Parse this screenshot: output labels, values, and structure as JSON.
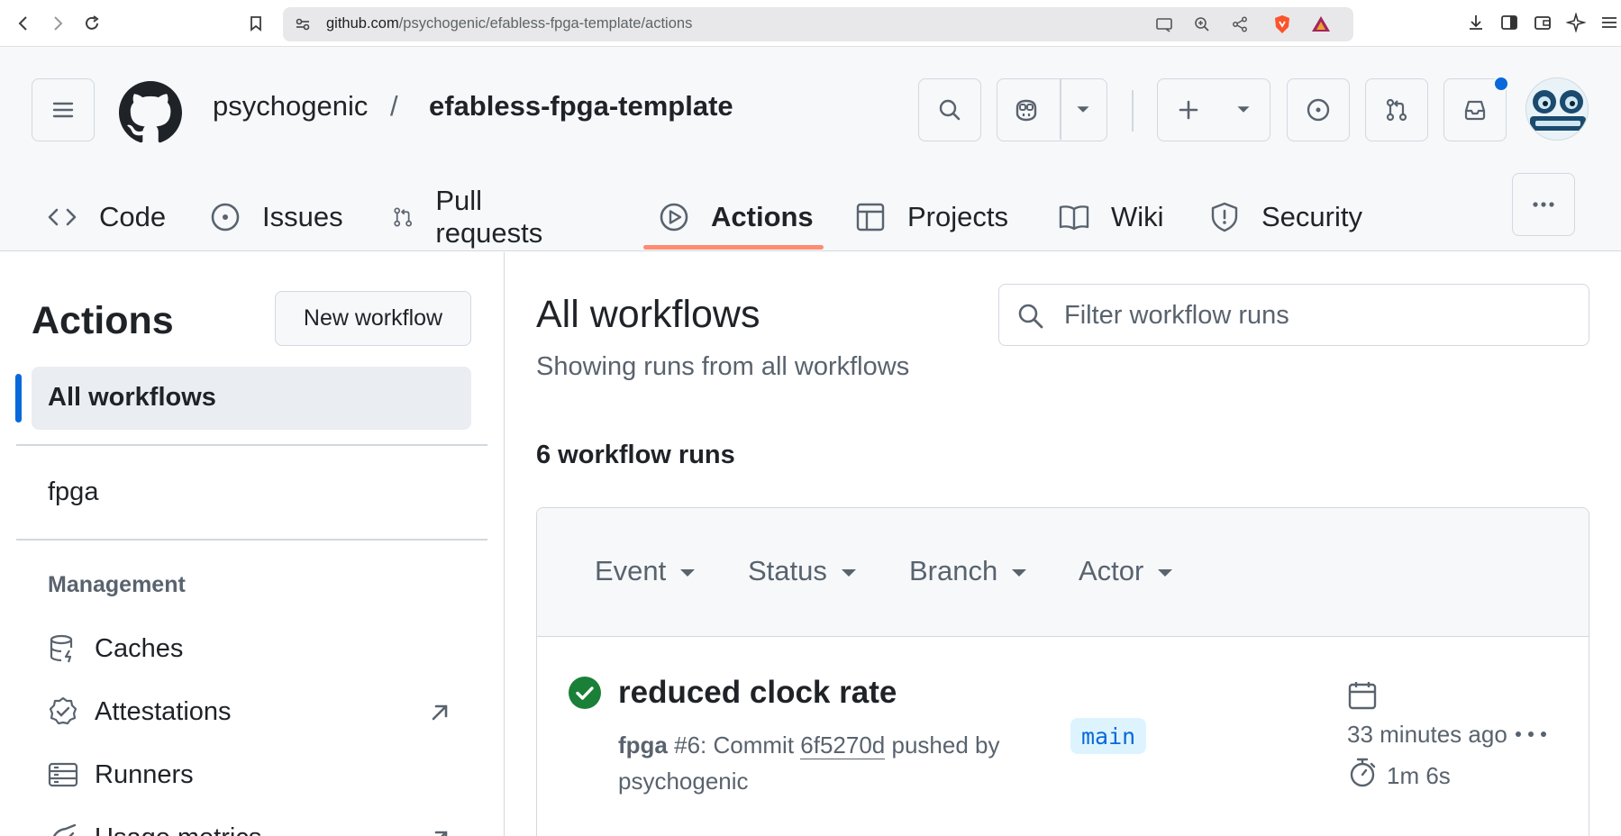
{
  "browser": {
    "url_host": "github.com",
    "url_path": "/psychogenic/efabless-fpga-template/actions"
  },
  "header": {
    "owner": "psychogenic",
    "separator": "/",
    "repo": "efabless-fpga-template"
  },
  "repo_nav": {
    "tabs": [
      {
        "label": "Code",
        "icon": "code-icon"
      },
      {
        "label": "Issues",
        "icon": "issue-opened-icon"
      },
      {
        "label": "Pull requests",
        "icon": "git-pull-request-icon"
      },
      {
        "label": "Actions",
        "icon": "play-icon",
        "active": true
      },
      {
        "label": "Projects",
        "icon": "table-icon"
      },
      {
        "label": "Wiki",
        "icon": "book-icon"
      },
      {
        "label": "Security",
        "icon": "shield-icon"
      }
    ]
  },
  "sidebar": {
    "title": "Actions",
    "new_workflow": "New workflow",
    "all_workflows": "All workflows",
    "workflow_fpga": "fpga",
    "management_heading": "Management",
    "management_items": [
      {
        "label": "Caches",
        "icon": "database-icon"
      },
      {
        "label": "Attestations",
        "icon": "verified-icon",
        "external": true
      },
      {
        "label": "Runners",
        "icon": "server-icon"
      },
      {
        "label": "Usage metrics",
        "icon": "graph-icon",
        "external": true
      }
    ]
  },
  "main": {
    "title": "All workflows",
    "subtitle": "Showing runs from all workflows",
    "filter_placeholder": "Filter workflow runs",
    "runs_count": "6 workflow runs",
    "filters": [
      "Event",
      "Status",
      "Branch",
      "Actor"
    ],
    "runs": [
      {
        "status": "success",
        "title": "reduced clock rate",
        "workflow": "fpga",
        "run_number": "#6",
        "meta_mid": ": Commit ",
        "commit": "6f5270d",
        "meta_tail": " pushed by",
        "actor": "psychogenic",
        "branch": "main",
        "time_ago": "33 minutes ago",
        "duration": "1m 6s"
      }
    ]
  },
  "colors": {
    "accent": "#0969da",
    "tab_underline": "#fd8c73",
    "success": "#1a7f37",
    "branch_bg": "#ddf4ff"
  }
}
